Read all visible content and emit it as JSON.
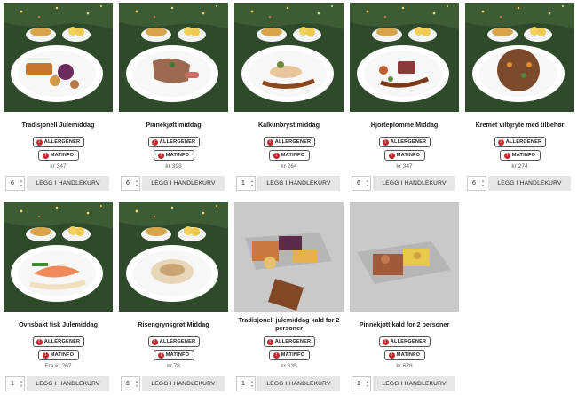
{
  "products": [
    {
      "name": "Tradisjonell Julemiddag",
      "price": "kr 347",
      "qty": "6",
      "kind": "plate-ribbe"
    },
    {
      "name": "Pinnekjøtt middag",
      "price": "kr 398",
      "qty": "6",
      "kind": "plate-pinne"
    },
    {
      "name": "Kalkunbryst middag",
      "price": "kr 264",
      "qty": "1",
      "kind": "plate-kalkun"
    },
    {
      "name": "Hjorteplomme Middag",
      "price": "kr 347",
      "qty": "6",
      "kind": "plate-hjort"
    },
    {
      "name": "Kremet viltgryte med tilbehør",
      "price": "kr 274",
      "qty": "6",
      "kind": "plate-gryte"
    },
    {
      "name": "Ovnsbakt fisk Julemiddag",
      "price": "Fra kr 267",
      "qty": "1",
      "kind": "plate-fisk"
    },
    {
      "name": "Risengrynsgrøt Middag",
      "price": "kr 78",
      "qty": "6",
      "kind": "plate-grot"
    },
    {
      "name": "Tradisjonell julemiddag kald for 2 personer",
      "price": "kr 635",
      "qty": "1",
      "kind": "tray-ribbe"
    },
    {
      "name": "Pinnekjøtt kald for 2 personer",
      "price": "kr 678",
      "qty": "1",
      "kind": "tray-pinne"
    }
  ],
  "labels": {
    "allergen": "ALLERGENER",
    "matinfo": "MATINFO",
    "add_to_cart": "LEGG I HANDLEKURV",
    "warn_glyph": "!",
    "spin_up": "▲",
    "spin_down": "▼"
  },
  "colors": {
    "warn": "#c0282d",
    "button_bg": "#e6e6e6",
    "photo_green": "#2f4a2a",
    "tray_bg": "#c9c9c9"
  }
}
